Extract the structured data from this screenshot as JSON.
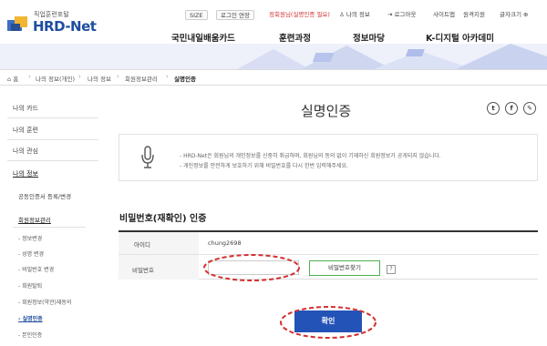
{
  "header": {
    "logo_sub": "직업훈련포털",
    "logo_main": "HRD-Net",
    "font_size_value": "SIZE",
    "logout_extend": "로그인 연장",
    "user_greeting": "정회원님(실명인증 필요)",
    "my_info": "나의 정보",
    "logout": "로그아웃",
    "sitemap": "사이트맵",
    "remote_support": "원격지원",
    "font_size": "글자크기",
    "nav": [
      "국민내일배움카드",
      "훈련과정",
      "정보마당",
      "K-디지털 아카데미"
    ]
  },
  "breadcrumb": [
    "홈",
    "나의 정보(개인)",
    "나의 정보",
    "회원정보관리",
    "실명인증"
  ],
  "sidebar": {
    "items": [
      "나의 카드",
      "나의 훈련",
      "나의 관심",
      "나의 정보",
      "공동인증서 등록/변경",
      "회원정보관리"
    ],
    "sub_items": [
      "정보변경",
      "성명 변경",
      "비밀번호 변경",
      "회원탈퇴",
      "회원정보(약관)재동의",
      "실명인증",
      "본인인증"
    ]
  },
  "main": {
    "title": "실명인증",
    "sns": [
      "t",
      "f",
      "✎"
    ],
    "notice": [
      "HRD-Net은 회원님의 개인정보를 신중히 취급하며, 회원님의 동의 없이 기재하신 회원정보가 공개되지 않습니다.",
      "개인정보를 안전하게 보호하기 위해 비밀번호를 다시 한번 입력해주세요."
    ],
    "section_title": "비밀번호(재확인) 인증",
    "id_label": "아이디",
    "id_value": "chung2698",
    "pw_label": "비밀번호",
    "find_pw": "비밀번호찾기",
    "help": "?",
    "confirm": "확인"
  },
  "colors": {
    "brand": "#1f4e9e",
    "confirm": "#2453b8",
    "highlight": "#d32f2f"
  }
}
